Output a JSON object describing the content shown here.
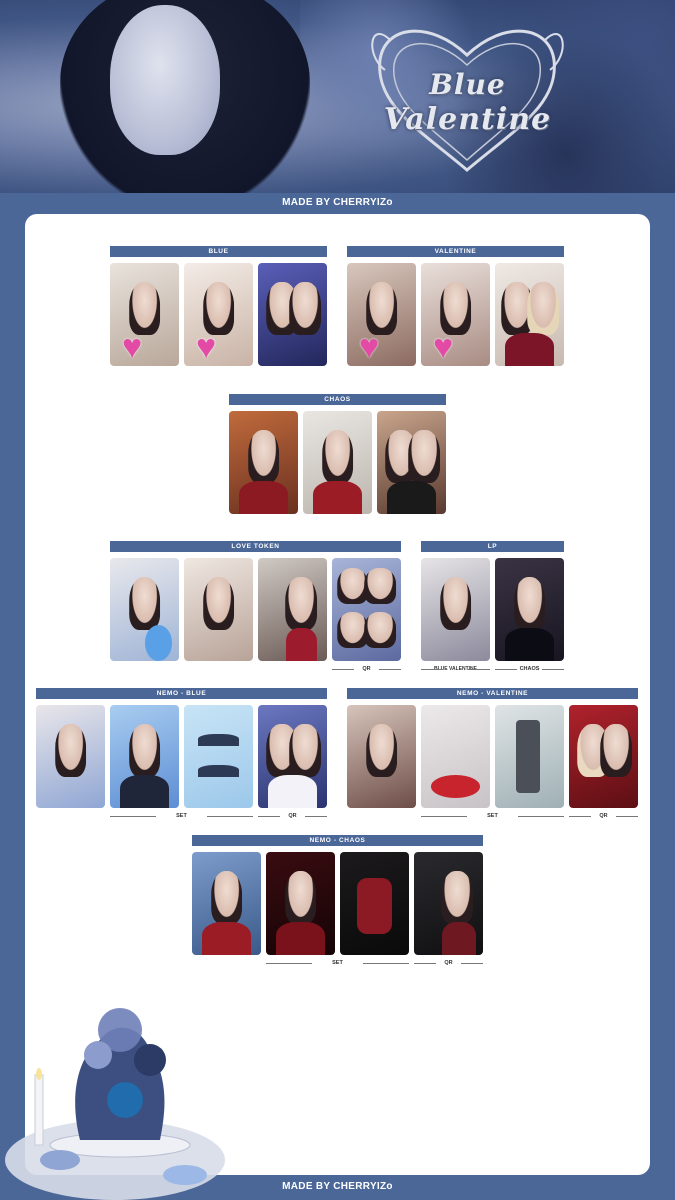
{
  "banner": {
    "title_line1": "Blue",
    "title_line2": "Valentine"
  },
  "credit_top": "MADE BY CHERRYIZo",
  "credit_bottom": "MADE BY CHERRYIZo",
  "sections": {
    "blue": {
      "label": "BLUE"
    },
    "valentine": {
      "label": "VALENTINE"
    },
    "chaos": {
      "label": "CHAOS"
    },
    "love_token": {
      "label": "LOVE TOKEN",
      "sub_qr": "QR"
    },
    "lp": {
      "label": "LP",
      "sub_1": "BLUE VALENTINE",
      "sub_2": "CHAOS"
    },
    "nemo_blue": {
      "label": "NEMO - BLUE",
      "sub_set": "SET",
      "sub_qr": "QR"
    },
    "nemo_valentine": {
      "label": "NEMO - VALENTINE",
      "sub_set": "SET",
      "sub_qr": "QR"
    },
    "nemo_chaos": {
      "label": "NEMO - CHAOS",
      "sub_set": "SET",
      "sub_qr": "QR"
    }
  },
  "icons": [
    "heart-sparkle-sticker"
  ],
  "colors": {
    "accent": "#4a6797",
    "card": "#ffffff",
    "heart": "#e24aa6"
  }
}
